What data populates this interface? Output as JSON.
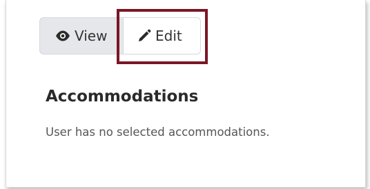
{
  "toggle": {
    "view_label": "View",
    "edit_label": "Edit"
  },
  "accommodations": {
    "title": "Accommodations",
    "empty_message": "User has no selected accommodations."
  },
  "colors": {
    "highlight_border": "#7a1626",
    "view_bg": "#e5e7ea",
    "text": "#333333"
  },
  "icons": {
    "view": "eye-icon",
    "edit": "pencil-icon"
  }
}
